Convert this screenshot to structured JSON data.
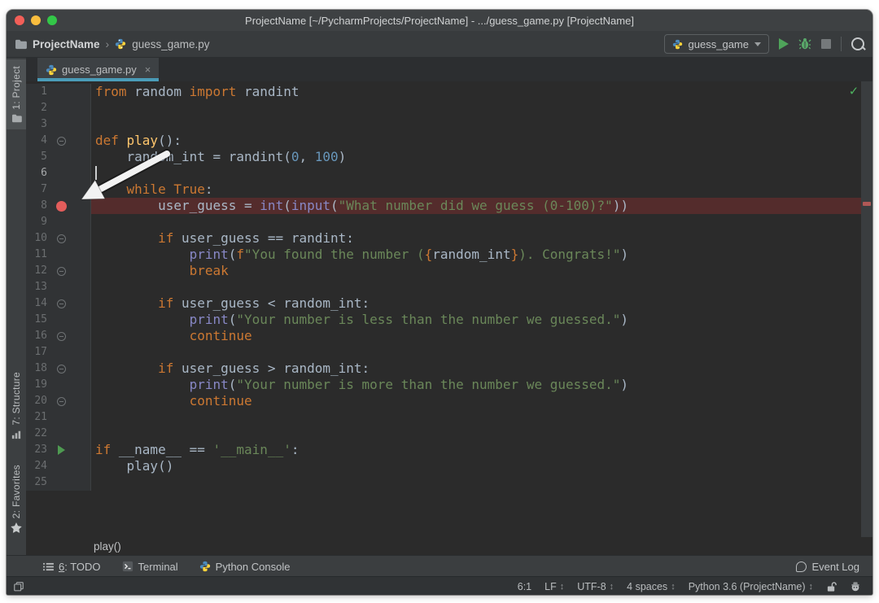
{
  "titlebar": {
    "title": "ProjectName [~/PycharmProjects/ProjectName] - .../guess_game.py [ProjectName]"
  },
  "navbar": {
    "project": "ProjectName",
    "separator": "›",
    "file": "guess_game.py",
    "run_config": "guess_game"
  },
  "tab": {
    "label": "guess_game.py",
    "close": "×"
  },
  "stripe": {
    "top": [
      {
        "num": "1",
        "rest": ": Project",
        "icon": "folder",
        "active": true
      }
    ],
    "bottom": [
      {
        "num": "7",
        "rest": ": Structure",
        "icon": "structure",
        "active": false
      },
      {
        "num": "2",
        "rest": ": Favorites",
        "icon": "star",
        "active": false
      }
    ]
  },
  "editor": {
    "current_line": 6,
    "breakpoint_line": 8,
    "run_line": 23,
    "fold_lines": [
      4,
      10,
      12,
      14,
      16,
      18,
      20
    ],
    "status_ok_glyph": "✓",
    "lines": [
      {
        "n": 1,
        "tokens": [
          [
            "k",
            "from"
          ],
          [
            "p",
            " random "
          ],
          [
            "k",
            "import"
          ],
          [
            "p",
            " randint"
          ]
        ]
      },
      {
        "n": 2,
        "tokens": []
      },
      {
        "n": 3,
        "tokens": []
      },
      {
        "n": 4,
        "tokens": [
          [
            "k",
            "def "
          ],
          [
            "f",
            "play"
          ],
          [
            "p",
            "():"
          ]
        ]
      },
      {
        "n": 5,
        "tokens": [
          [
            "p",
            "    random_int = randint("
          ],
          [
            "n",
            "0"
          ],
          [
            "p",
            ", "
          ],
          [
            "n",
            "100"
          ],
          [
            "p",
            ")"
          ]
        ]
      },
      {
        "n": 6,
        "tokens": []
      },
      {
        "n": 7,
        "tokens": [
          [
            "p",
            "    "
          ],
          [
            "k",
            "while "
          ],
          [
            "k",
            "True"
          ],
          [
            "p",
            ":"
          ]
        ]
      },
      {
        "n": 8,
        "tokens": [
          [
            "p",
            "        user_guess = "
          ],
          [
            "b",
            "int"
          ],
          [
            "p",
            "("
          ],
          [
            "b",
            "input"
          ],
          [
            "p",
            "("
          ],
          [
            "s",
            "\"What number did we guess (0-100)?\""
          ],
          [
            "p",
            "))"
          ]
        ]
      },
      {
        "n": 9,
        "tokens": []
      },
      {
        "n": 10,
        "tokens": [
          [
            "p",
            "        "
          ],
          [
            "k",
            "if"
          ],
          [
            "p",
            " user_guess == randint:"
          ]
        ]
      },
      {
        "n": 11,
        "tokens": [
          [
            "p",
            "            "
          ],
          [
            "b",
            "print"
          ],
          [
            "p",
            "("
          ],
          [
            "k",
            "f"
          ],
          [
            "s",
            "\"You found the number ("
          ],
          [
            "o",
            "{"
          ],
          [
            "p",
            "random_int"
          ],
          [
            "o",
            "}"
          ],
          [
            "s",
            "). Congrats!\""
          ],
          [
            "p",
            ")"
          ]
        ]
      },
      {
        "n": 12,
        "tokens": [
          [
            "p",
            "            "
          ],
          [
            "k",
            "break"
          ]
        ]
      },
      {
        "n": 13,
        "tokens": []
      },
      {
        "n": 14,
        "tokens": [
          [
            "p",
            "        "
          ],
          [
            "k",
            "if"
          ],
          [
            "p",
            " user_guess < random_int:"
          ]
        ]
      },
      {
        "n": 15,
        "tokens": [
          [
            "p",
            "            "
          ],
          [
            "b",
            "print"
          ],
          [
            "p",
            "("
          ],
          [
            "s",
            "\"Your number is less than the number we guessed.\""
          ],
          [
            "p",
            ")"
          ]
        ]
      },
      {
        "n": 16,
        "tokens": [
          [
            "p",
            "            "
          ],
          [
            "k",
            "continue"
          ]
        ]
      },
      {
        "n": 17,
        "tokens": []
      },
      {
        "n": 18,
        "tokens": [
          [
            "p",
            "        "
          ],
          [
            "k",
            "if"
          ],
          [
            "p",
            " user_guess > random_int:"
          ]
        ]
      },
      {
        "n": 19,
        "tokens": [
          [
            "p",
            "            "
          ],
          [
            "b",
            "print"
          ],
          [
            "p",
            "("
          ],
          [
            "s",
            "\"Your number is more than the number we guessed.\""
          ],
          [
            "p",
            ")"
          ]
        ]
      },
      {
        "n": 20,
        "tokens": [
          [
            "p",
            "            "
          ],
          [
            "k",
            "continue"
          ]
        ]
      },
      {
        "n": 21,
        "tokens": []
      },
      {
        "n": 22,
        "tokens": []
      },
      {
        "n": 23,
        "tokens": [
          [
            "k",
            "if"
          ],
          [
            "p",
            " __name__ == "
          ],
          [
            "s",
            "'__main__'"
          ],
          [
            "p",
            ":"
          ]
        ]
      },
      {
        "n": 24,
        "tokens": [
          [
            "p",
            "    play()"
          ]
        ]
      },
      {
        "n": 25,
        "tokens": []
      }
    ]
  },
  "breadcrumbs": {
    "label": "play()"
  },
  "toolbar": {
    "items": [
      {
        "icon": "list",
        "num": "6",
        "rest": ": TODO"
      },
      {
        "icon": "terminal",
        "num": "",
        "rest": "Terminal"
      },
      {
        "icon": "python",
        "num": "",
        "rest": "Python Console"
      }
    ],
    "right": {
      "icon": "balloon",
      "label": "Event Log"
    }
  },
  "statusbar": {
    "position": "6:1",
    "items": [
      {
        "label": "LF",
        "spinner": "↕"
      },
      {
        "label": "UTF-8",
        "spinner": "↕"
      },
      {
        "label": "4 spaces",
        "spinner": "↕"
      },
      {
        "label": "Python 3.6 (ProjectName)",
        "spinner": "↕"
      }
    ]
  },
  "colors": {
    "accent_tab_underline": "#4A9CB8",
    "breakpoint_red": "#E35D5B",
    "breakpoint_line_bg": "#542c2c",
    "run_green": "#4FA45A",
    "editor_bg": "#2b2b2b",
    "chrome_bg": "#3c3f41",
    "keyword_orange": "#cc7832",
    "string_green": "#6a8759",
    "number_blue": "#6897bb",
    "builtin_purple": "#8888c6",
    "function_yellow": "#ffc66d"
  }
}
